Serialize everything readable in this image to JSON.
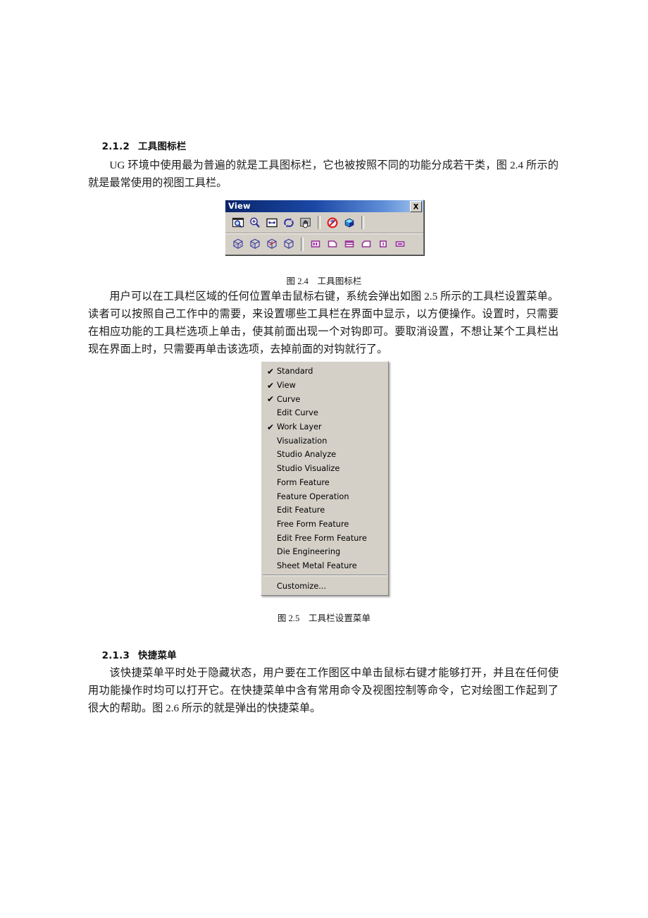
{
  "document": {
    "section_2_1_2": {
      "number": "2.1.2",
      "title": "工具图标栏",
      "body": "UG 环境中使用最为普遍的就是工具图标栏，它也被按照不同的功能分成若干类，图 2.4 所示的就是最常使用的视图工具栏。"
    },
    "figure_2_4": {
      "caption": "图 2.4    工具图标栏"
    },
    "paragraph_after_fig_2_4": "用户可以在工具栏区域的任何位置单击鼠标右键，系统会弹出如图 2.5 所示的工具栏设置菜单。读者可以按照自己工作中的需要，来设置哪些工具栏在界面中显示，以方便操作。设置时，只需要在相应功能的工具栏选项上单击，使其前面出现一个对钩即可。要取消设置，不想让某个工具栏出现在界面上时，只需要再单击该选项，去掉前面的对钩就行了。",
    "figure_2_5": {
      "caption": "图 2.5    工具栏设置菜单"
    },
    "section_2_1_3": {
      "number": "2.1.3",
      "title": "快捷菜单",
      "body": "该快捷菜单平时处于隐藏状态，用户要在工作图区中单击鼠标右键才能够打开，并且在任何使用功能操作时均可以打开它。在快捷菜单中含有常用命令及视图控制等命令，它对绘图工作起到了很大的帮助。图 2.6 所示的就是弹出的快捷菜单。"
    }
  },
  "view_toolbar": {
    "title": "View",
    "close_icon": "close-icon",
    "row1": [
      {
        "name": "fit-view-icon",
        "icon": "zoom-fit"
      },
      {
        "name": "zoom-in-icon",
        "icon": "magnifier-plus"
      },
      {
        "name": "zoom-area-icon",
        "icon": "fit-box"
      },
      {
        "name": "rotate-icon",
        "icon": "rotate-arrows"
      },
      {
        "name": "pan-icon",
        "icon": "hand-pan"
      },
      {
        "name": "separator",
        "icon": "separator"
      },
      {
        "name": "no-shade-icon",
        "icon": "prohibited"
      },
      {
        "name": "shaded-cube-icon",
        "icon": "cube-shaded"
      },
      {
        "name": "separator",
        "icon": "separator"
      }
    ],
    "row2": [
      {
        "name": "trimetric-view-icon",
        "icon": "cube-wire"
      },
      {
        "name": "isometric-view-icon",
        "icon": "cube-wire"
      },
      {
        "name": "orient-view-icon",
        "icon": "cube-wire-axes"
      },
      {
        "name": "perspective-view-icon",
        "icon": "cube-plain"
      },
      {
        "name": "separator",
        "icon": "separator"
      },
      {
        "name": "layout-two-vertical-icon",
        "icon": "layout-two-v"
      },
      {
        "name": "layout-single-icon",
        "icon": "layout-single"
      },
      {
        "name": "layout-two-horizontal-icon",
        "icon": "layout-two-h"
      },
      {
        "name": "layout-corner-icon",
        "icon": "layout-corner"
      },
      {
        "name": "layout-narrow-icon",
        "icon": "layout-narrow"
      },
      {
        "name": "layout-wide-icon",
        "icon": "layout-wide"
      }
    ],
    "colors": {
      "title_start": "#0a246a",
      "title_end": "#a6c8ee",
      "face": "#d4d0c8",
      "icon_blue": "#3b3b9e",
      "icon_purple": "#993399",
      "icon_red": "#e02020",
      "icon_cyan": "#00c8f0"
    }
  },
  "toolbar_menu": {
    "items": [
      {
        "label": "Standard",
        "checked": true
      },
      {
        "label": "View",
        "checked": true
      },
      {
        "label": "Curve",
        "checked": true
      },
      {
        "label": "Edit Curve",
        "checked": false
      },
      {
        "label": "Work Layer",
        "checked": true
      },
      {
        "label": "Visualization",
        "checked": false
      },
      {
        "label": "Studio Analyze",
        "checked": false
      },
      {
        "label": "Studio Visualize",
        "checked": false
      },
      {
        "label": "Form Feature",
        "checked": false
      },
      {
        "label": "Feature Operation",
        "checked": false
      },
      {
        "label": "Edit Feature",
        "checked": false
      },
      {
        "label": "Free Form Feature",
        "checked": false
      },
      {
        "label": "Edit Free Form Feature",
        "checked": false
      },
      {
        "label": "Die Engineering",
        "checked": false
      },
      {
        "label": "Sheet Metal Feature",
        "checked": false
      }
    ],
    "customize": {
      "label": "Customize...",
      "checked": false
    },
    "check_glyph": "✔"
  }
}
